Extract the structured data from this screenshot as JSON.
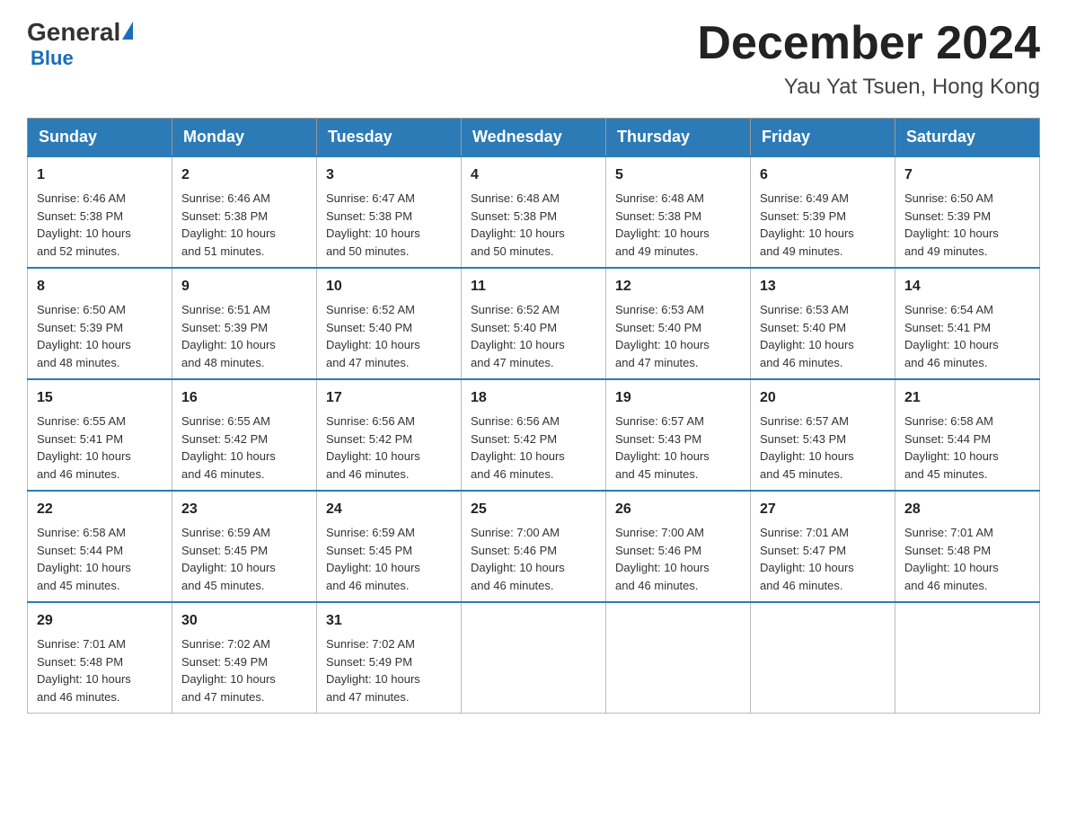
{
  "logo": {
    "general": "General",
    "triangle": "",
    "blue": "Blue"
  },
  "header": {
    "month_year": "December 2024",
    "location": "Yau Yat Tsuen, Hong Kong"
  },
  "weekdays": [
    "Sunday",
    "Monday",
    "Tuesday",
    "Wednesday",
    "Thursday",
    "Friday",
    "Saturday"
  ],
  "weeks": [
    [
      {
        "day": "1",
        "sunrise": "6:46 AM",
        "sunset": "5:38 PM",
        "daylight_h": "10",
        "daylight_m": "52"
      },
      {
        "day": "2",
        "sunrise": "6:46 AM",
        "sunset": "5:38 PM",
        "daylight_h": "10",
        "daylight_m": "51"
      },
      {
        "day": "3",
        "sunrise": "6:47 AM",
        "sunset": "5:38 PM",
        "daylight_h": "10",
        "daylight_m": "50"
      },
      {
        "day": "4",
        "sunrise": "6:48 AM",
        "sunset": "5:38 PM",
        "daylight_h": "10",
        "daylight_m": "50"
      },
      {
        "day": "5",
        "sunrise": "6:48 AM",
        "sunset": "5:38 PM",
        "daylight_h": "10",
        "daylight_m": "49"
      },
      {
        "day": "6",
        "sunrise": "6:49 AM",
        "sunset": "5:39 PM",
        "daylight_h": "10",
        "daylight_m": "49"
      },
      {
        "day": "7",
        "sunrise": "6:50 AM",
        "sunset": "5:39 PM",
        "daylight_h": "10",
        "daylight_m": "49"
      }
    ],
    [
      {
        "day": "8",
        "sunrise": "6:50 AM",
        "sunset": "5:39 PM",
        "daylight_h": "10",
        "daylight_m": "48"
      },
      {
        "day": "9",
        "sunrise": "6:51 AM",
        "sunset": "5:39 PM",
        "daylight_h": "10",
        "daylight_m": "48"
      },
      {
        "day": "10",
        "sunrise": "6:52 AM",
        "sunset": "5:40 PM",
        "daylight_h": "10",
        "daylight_m": "47"
      },
      {
        "day": "11",
        "sunrise": "6:52 AM",
        "sunset": "5:40 PM",
        "daylight_h": "10",
        "daylight_m": "47"
      },
      {
        "day": "12",
        "sunrise": "6:53 AM",
        "sunset": "5:40 PM",
        "daylight_h": "10",
        "daylight_m": "47"
      },
      {
        "day": "13",
        "sunrise": "6:53 AM",
        "sunset": "5:40 PM",
        "daylight_h": "10",
        "daylight_m": "46"
      },
      {
        "day": "14",
        "sunrise": "6:54 AM",
        "sunset": "5:41 PM",
        "daylight_h": "10",
        "daylight_m": "46"
      }
    ],
    [
      {
        "day": "15",
        "sunrise": "6:55 AM",
        "sunset": "5:41 PM",
        "daylight_h": "10",
        "daylight_m": "46"
      },
      {
        "day": "16",
        "sunrise": "6:55 AM",
        "sunset": "5:42 PM",
        "daylight_h": "10",
        "daylight_m": "46"
      },
      {
        "day": "17",
        "sunrise": "6:56 AM",
        "sunset": "5:42 PM",
        "daylight_h": "10",
        "daylight_m": "46"
      },
      {
        "day": "18",
        "sunrise": "6:56 AM",
        "sunset": "5:42 PM",
        "daylight_h": "10",
        "daylight_m": "46"
      },
      {
        "day": "19",
        "sunrise": "6:57 AM",
        "sunset": "5:43 PM",
        "daylight_h": "10",
        "daylight_m": "45"
      },
      {
        "day": "20",
        "sunrise": "6:57 AM",
        "sunset": "5:43 PM",
        "daylight_h": "10",
        "daylight_m": "45"
      },
      {
        "day": "21",
        "sunrise": "6:58 AM",
        "sunset": "5:44 PM",
        "daylight_h": "10",
        "daylight_m": "45"
      }
    ],
    [
      {
        "day": "22",
        "sunrise": "6:58 AM",
        "sunset": "5:44 PM",
        "daylight_h": "10",
        "daylight_m": "45"
      },
      {
        "day": "23",
        "sunrise": "6:59 AM",
        "sunset": "5:45 PM",
        "daylight_h": "10",
        "daylight_m": "45"
      },
      {
        "day": "24",
        "sunrise": "6:59 AM",
        "sunset": "5:45 PM",
        "daylight_h": "10",
        "daylight_m": "46"
      },
      {
        "day": "25",
        "sunrise": "7:00 AM",
        "sunset": "5:46 PM",
        "daylight_h": "10",
        "daylight_m": "46"
      },
      {
        "day": "26",
        "sunrise": "7:00 AM",
        "sunset": "5:46 PM",
        "daylight_h": "10",
        "daylight_m": "46"
      },
      {
        "day": "27",
        "sunrise": "7:01 AM",
        "sunset": "5:47 PM",
        "daylight_h": "10",
        "daylight_m": "46"
      },
      {
        "day": "28",
        "sunrise": "7:01 AM",
        "sunset": "5:48 PM",
        "daylight_h": "10",
        "daylight_m": "46"
      }
    ],
    [
      {
        "day": "29",
        "sunrise": "7:01 AM",
        "sunset": "5:48 PM",
        "daylight_h": "10",
        "daylight_m": "46"
      },
      {
        "day": "30",
        "sunrise": "7:02 AM",
        "sunset": "5:49 PM",
        "daylight_h": "10",
        "daylight_m": "47"
      },
      {
        "day": "31",
        "sunrise": "7:02 AM",
        "sunset": "5:49 PM",
        "daylight_h": "10",
        "daylight_m": "47"
      },
      null,
      null,
      null,
      null
    ]
  ],
  "labels": {
    "sunrise": "Sunrise:",
    "sunset": "Sunset:",
    "daylight": "Daylight: 10 hours"
  }
}
